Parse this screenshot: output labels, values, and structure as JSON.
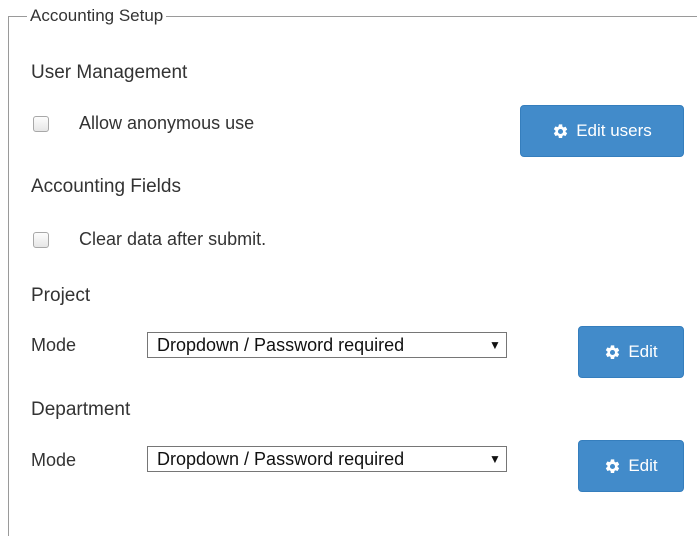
{
  "fieldset": {
    "legend": "Accounting Setup"
  },
  "user_management": {
    "heading": "User Management",
    "allow_anonymous_label": "Allow anonymous use",
    "allow_anonymous_checked": false,
    "edit_users_label": "Edit users",
    "edit_users_icon": "gear-icon"
  },
  "accounting_fields": {
    "heading": "Accounting Fields",
    "clear_data_label": "Clear data after submit.",
    "clear_data_checked": false
  },
  "project": {
    "heading": "Project",
    "mode_label": "Mode",
    "mode_value": "Dropdown / Password required",
    "edit_label": "Edit",
    "edit_icon": "gear-icon"
  },
  "department": {
    "heading": "Department",
    "mode_label": "Mode",
    "mode_value": "Dropdown / Password required",
    "edit_label": "Edit",
    "edit_icon": "gear-icon"
  },
  "colors": {
    "button_primary": "#428bca",
    "text": "#333333",
    "border": "#9a9a9a"
  }
}
